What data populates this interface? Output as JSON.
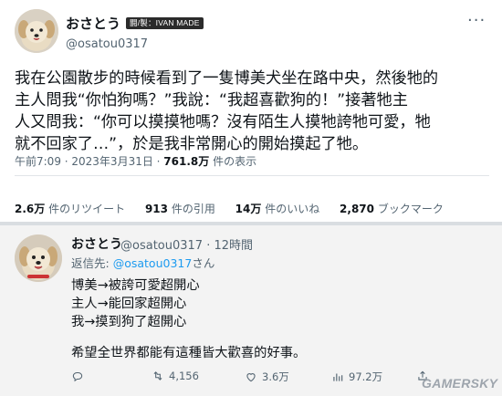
{
  "tweet": {
    "display_name": "おさとう",
    "badge": "闘/製：IVAN MADE",
    "handle": "@osatou0317",
    "lines": [
      "我在公園散步的時候看到了一隻博美犬坐在路中央，然後牠的",
      "主人問我“你怕狗嗎？”我說：“我超喜歡狗的！”接著牠主",
      "人又問我：“你可以摸摸牠嗎？沒有陌生人摸牠誇牠可愛，牠",
      "就不回家了…”，於是我非常開心的開始摸起了牠。"
    ],
    "meta_time": "午前7:09 · 2023年3月31日 ·",
    "meta_views": "761.8万",
    "meta_views_label": "件の表示",
    "stats": [
      {
        "value": "2.6万",
        "label": "件のリツイート"
      },
      {
        "value": "913",
        "label": "件の引用"
      },
      {
        "value": "14万",
        "label": "件のいいね"
      },
      {
        "value": "2,870",
        "label": "ブックマーク"
      }
    ]
  },
  "reply": {
    "display_name": "おさとう",
    "handle_time": "@osatou0317 · 12時間",
    "replying_prefix": "返信先:",
    "replying_handle": "@osatou0317",
    "replying_suffix": "さん",
    "lines": [
      "博美→被誇可愛超開心",
      "主人→能回家超開心",
      "我→摸到狗了超開心"
    ],
    "wish": "希望全世界都能有這種皆大歡喜的好事。",
    "actions": {
      "retweets": "4,156",
      "likes": "3.6万",
      "views": "97.2万"
    }
  },
  "watermark": "GAMERSKY",
  "icons": [
    "dog-avatar",
    "more-icon",
    "reply-icon",
    "retweet-icon",
    "like-icon",
    "views-icon",
    "share-icon"
  ],
  "colors": {
    "link": "#1d9bf0",
    "muted": "#536471",
    "text": "#0f1419"
  }
}
